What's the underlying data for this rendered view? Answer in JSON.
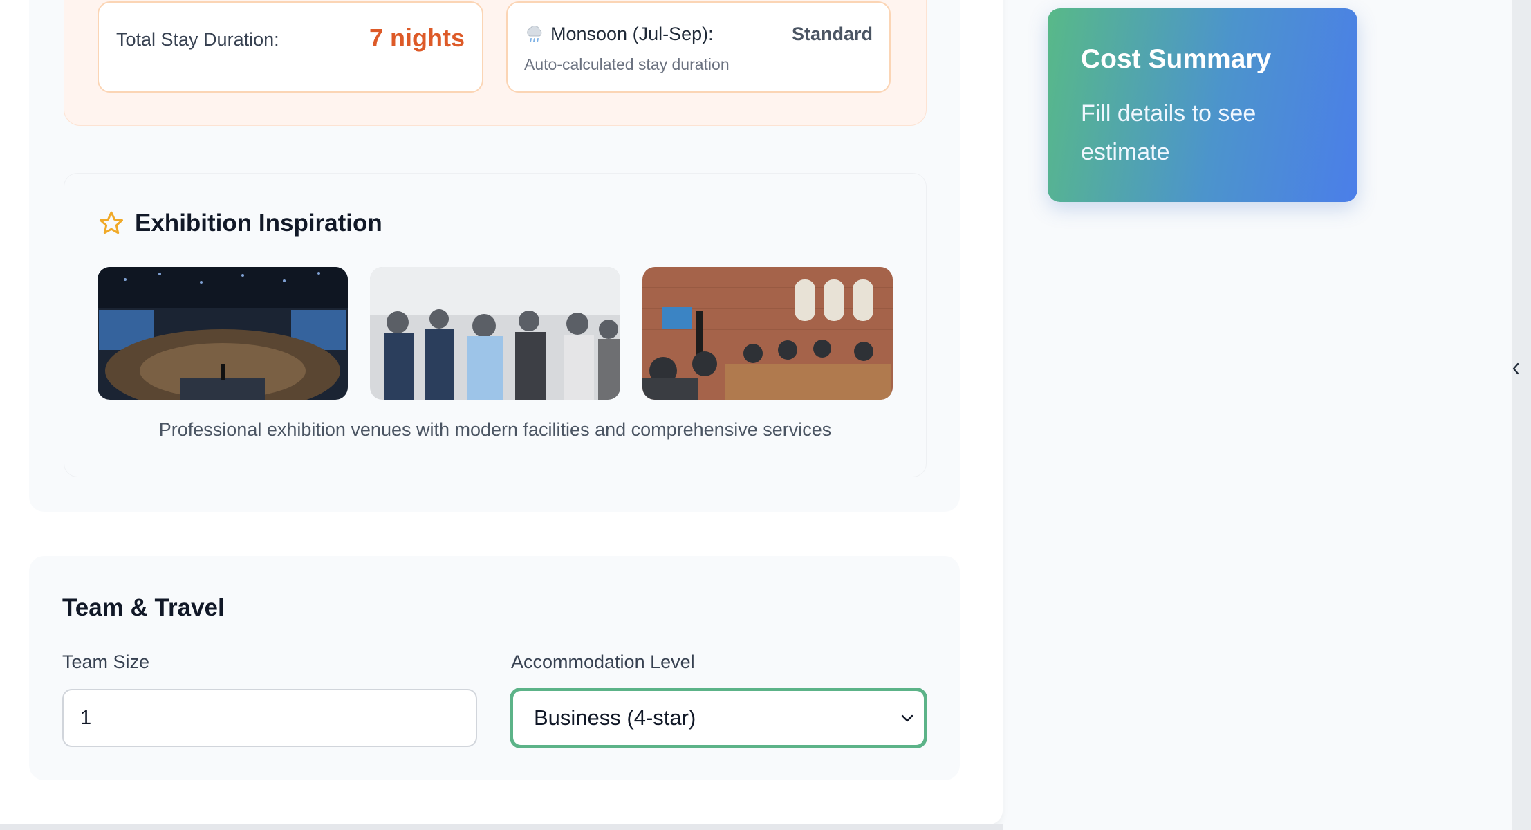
{
  "stay": {
    "duration_label": "Total Stay Duration:",
    "duration_value": "7 nights",
    "season_label": "Monsoon (Jul-Sep):",
    "season_value": "Standard",
    "season_note": "Auto-calculated stay duration",
    "season_icon": "rain-cloud-icon"
  },
  "inspiration": {
    "title": "Exhibition Inspiration",
    "icon": "star-icon",
    "caption": "Professional exhibition venues with modern facilities and comprehensive services"
  },
  "team": {
    "title": "Team & Travel",
    "team_size_label": "Team Size",
    "team_size_value": "1",
    "accommodation_label": "Accommodation Level",
    "accommodation_value": "Business (4-star)"
  },
  "cost_summary": {
    "title": "Cost Summary",
    "subtitle": "Fill details to see estimate"
  },
  "colors": {
    "accent_orange": "#dd5a28",
    "select_border": "#5cb388",
    "gradient_start": "#58b988",
    "gradient_end": "#4b7ee9"
  }
}
